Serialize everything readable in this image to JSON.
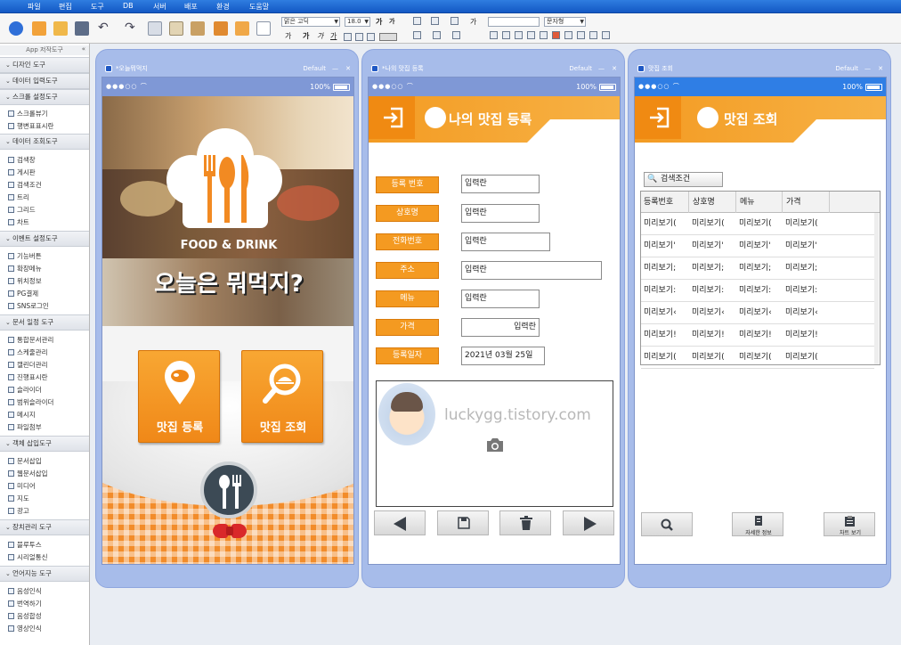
{
  "menu": [
    "파일",
    "편집",
    "도구",
    "DB",
    "서버",
    "배포",
    "환경",
    "도움말"
  ],
  "toolbar": {
    "font_name": "맑은 고딕",
    "font_size": "18.0",
    "style_select": "문자형"
  },
  "sidebar": {
    "title": "App 저작도구",
    "groups": [
      {
        "label": "디자인 도구",
        "items": []
      },
      {
        "label": "데이터 입력도구",
        "items": []
      },
      {
        "label": "스크롤 설정도구",
        "items": [
          "스크롤뷰기",
          "행변표표시란"
        ]
      },
      {
        "label": "데이터 조회도구",
        "items": [
          "검색창",
          "게시판",
          "검색조건",
          "트리",
          "그리드",
          "차트"
        ]
      },
      {
        "label": "이벤트 설정도구",
        "items": [
          "기능버튼",
          "확장메뉴",
          "위치정보",
          "PG결제",
          "SNS로그인"
        ]
      },
      {
        "label": "문서 일정 도구",
        "items": [
          "통합문서관리",
          "스케줄관리",
          "캘린더관리",
          "진행표시란",
          "슬라이더",
          "범위슬라이더",
          "메시지",
          "파일첨부"
        ]
      },
      {
        "label": "객체 삽입도구",
        "items": [
          "문서삽입",
          "웹문서삽입",
          "미디어",
          "지도",
          "광고"
        ]
      },
      {
        "label": "장치관리 도구",
        "items": [
          "블루투스",
          "시리얼통신"
        ]
      },
      {
        "label": "언어지능 도구",
        "items": [
          "음성인식",
          "번역하기",
          "음성합성",
          "영상인식"
        ]
      }
    ]
  },
  "status": {
    "pct": "100%"
  },
  "screen1": {
    "title": "*오늘뭐먹지",
    "default": "Default",
    "logo_text": "FOOD & DRINK",
    "headline": "오늘은 뭐먹지?",
    "btn_register": "맛집 등록",
    "btn_search": "맛집 조회",
    "colors": {
      "orange": "#f39b23",
      "check": "#f28c2a"
    }
  },
  "screen2": {
    "title": "*나의 맛집 등록",
    "default": "Default",
    "header": "나의 맛집 등록",
    "fields": [
      {
        "label": "등록 번호",
        "value": "입력란"
      },
      {
        "label": "상호명",
        "value": "입력란"
      },
      {
        "label": "전화번호",
        "value": "입력란"
      },
      {
        "label": "주소",
        "value": "입력란"
      },
      {
        "label": "메뉴",
        "value": "입력란"
      },
      {
        "label": "가격",
        "value": "입력란"
      },
      {
        "label": "등록일자",
        "value": "2021년 03월 25일"
      }
    ],
    "watermark": "luckygg.tistory.com"
  },
  "screen3": {
    "title": "맛집 조회",
    "default": "Default",
    "header": "맛집 조회",
    "search_btn": "검색조건",
    "columns": [
      "등록번호",
      "상호명",
      "메뉴",
      "가격"
    ],
    "rows": [
      [
        "미리보기(",
        "미리보기(",
        "미리보기(",
        "미리보기("
      ],
      [
        "미리보기'",
        "미리보기'",
        "미리보기'",
        "미리보기'"
      ],
      [
        "미리보기;",
        "미리보기;",
        "미리보기;",
        "미리보기;"
      ],
      [
        "미리보기:",
        "미리보기:",
        "미리보기:",
        "미리보기:"
      ],
      [
        "미리보기‹",
        "미리보기‹",
        "미리보기‹",
        "미리보기‹"
      ],
      [
        "미리보기!",
        "미리보기!",
        "미리보기!",
        "미리보기!"
      ],
      [
        "미리보기(",
        "미리보기(",
        "미리보기(",
        "미리보기("
      ]
    ],
    "btn_detail": "자세한 정보",
    "btn_chart": "차트 보기"
  }
}
